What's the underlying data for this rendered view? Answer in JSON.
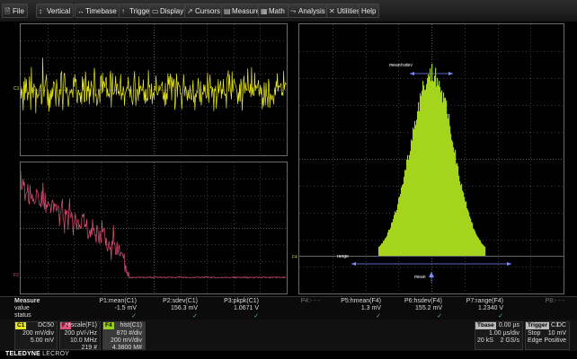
{
  "menubar": {
    "items": [
      {
        "label": "File",
        "icon": "file-icon",
        "glyph": "🗎"
      },
      {
        "label": "Vertical",
        "icon": "vertical-arrows-icon",
        "glyph": "↕"
      },
      {
        "label": "Timebase",
        "icon": "horizontal-arrows-icon",
        "glyph": "↔"
      },
      {
        "label": "Trigger",
        "icon": "trigger-icon",
        "glyph": "↑"
      },
      {
        "label": "Display",
        "icon": "display-icon",
        "glyph": "▭"
      },
      {
        "label": "Cursors",
        "icon": "cursor-icon",
        "glyph": "↗"
      },
      {
        "label": "Measure",
        "icon": "measure-icon",
        "glyph": "▤"
      },
      {
        "label": "Math",
        "icon": "math-icon",
        "glyph": "▦"
      },
      {
        "label": "Analysis",
        "icon": "analysis-icon",
        "glyph": "⤳"
      },
      {
        "label": "Utilities",
        "icon": "utilities-icon",
        "glyph": "✕"
      },
      {
        "label": "Help",
        "icon": "",
        "glyph": ""
      }
    ]
  },
  "grid_labels": {
    "c1": "C1",
    "f2": "F2",
    "f4": "F4"
  },
  "histogram_annotations": {
    "mean_sdev": "mean±sdev",
    "range": "range",
    "mean": "mean"
  },
  "measure": {
    "header": "Measure",
    "row_value": "value",
    "row_status": "status",
    "columns": [
      {
        "name": "P1:mean(C1)",
        "value": "-1.5 mV",
        "ok": true
      },
      {
        "name": "P2:sdev(C1)",
        "value": "156.3 mV",
        "ok": true
      },
      {
        "name": "P3:pkpk(C1)",
        "value": "1.0671 V",
        "ok": true
      },
      {
        "name": "P4:- - -",
        "value": "",
        "ok": false
      },
      {
        "name": "P5:hmean(F4)",
        "value": "1.3 mV",
        "ok": true
      },
      {
        "name": "P6:hsdev(F4)",
        "value": "155.2 mV",
        "ok": true
      },
      {
        "name": "P7:range(F4)",
        "value": "1.2340 V",
        "ok": true
      },
      {
        "name": "P8:- - -",
        "value": "",
        "ok": false
      }
    ],
    "check": "✓"
  },
  "descriptors": {
    "c1": {
      "tag": "C1",
      "coupling": "DC50",
      "vdiv": "200 mV/div",
      "offset": "5.00 mV",
      "color": "#e8e81c"
    },
    "f2": {
      "tag": "F2",
      "title": "rescale(F1)",
      "l1": "200 pV/√Hz",
      "l2": "10.0 MHz",
      "l3": "219 #",
      "color": "#e0507a"
    },
    "f4": {
      "tag": "F4",
      "title": "hist(C1)",
      "l1": "870 #/div",
      "l2": "200 mV/div",
      "l3": "4.3800 M#",
      "color": "#9ccc1c"
    }
  },
  "timebase": {
    "label": "Tbase",
    "delay": "0.00 µs",
    "tdiv": "1.00 µs/div",
    "samples": "20 kS",
    "rate": "2 GS/s"
  },
  "trigger": {
    "label": "Trigger",
    "source": "C1",
    "coupling": "DC",
    "mode": "Stop",
    "level": "10 mV",
    "type": "Edge",
    "slope": "Positive"
  },
  "brand": {
    "name": "TELEDYNE",
    "suffix": "LECROY"
  },
  "colors": {
    "c1": "#e8e81c",
    "f2": "#e0507a",
    "f4": "#a4d41c"
  }
}
